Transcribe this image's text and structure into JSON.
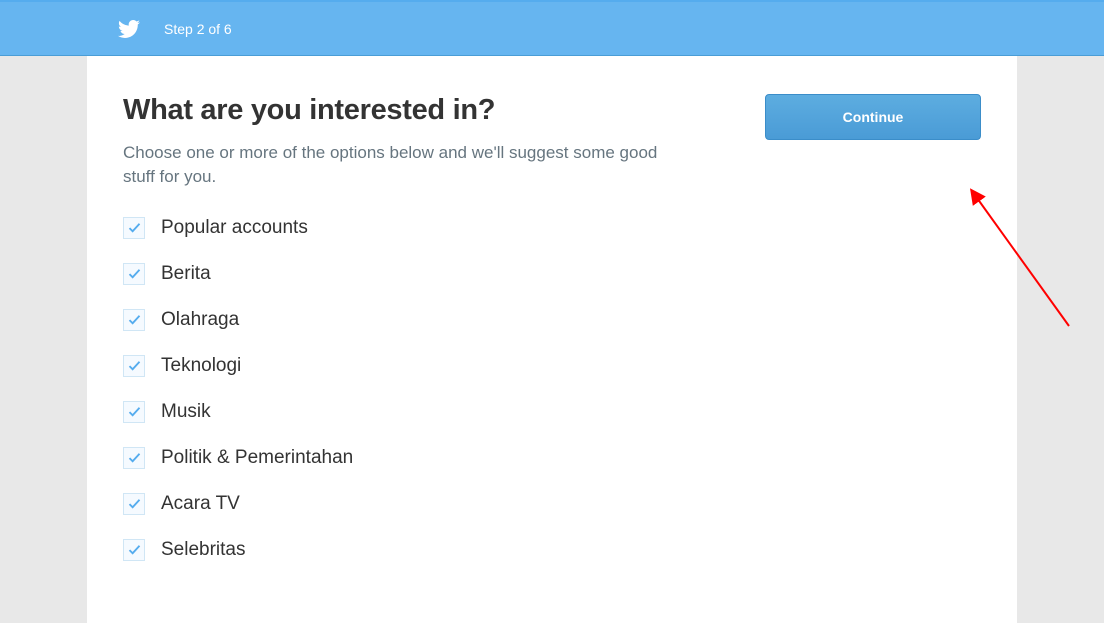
{
  "header": {
    "step_label": "Step 2 of 6"
  },
  "main": {
    "title": "What are you interested in?",
    "subtitle": "Choose one or more of the options below and we'll suggest some good stuff for you.",
    "continue_label": "Continue",
    "options": [
      {
        "label": "Popular accounts",
        "checked": true
      },
      {
        "label": "Berita",
        "checked": true
      },
      {
        "label": "Olahraga",
        "checked": true
      },
      {
        "label": "Teknologi",
        "checked": true
      },
      {
        "label": "Musik",
        "checked": true
      },
      {
        "label": "Politik & Pemerintahan",
        "checked": true
      },
      {
        "label": "Acara TV",
        "checked": true
      },
      {
        "label": "Selebritas",
        "checked": true
      }
    ]
  }
}
